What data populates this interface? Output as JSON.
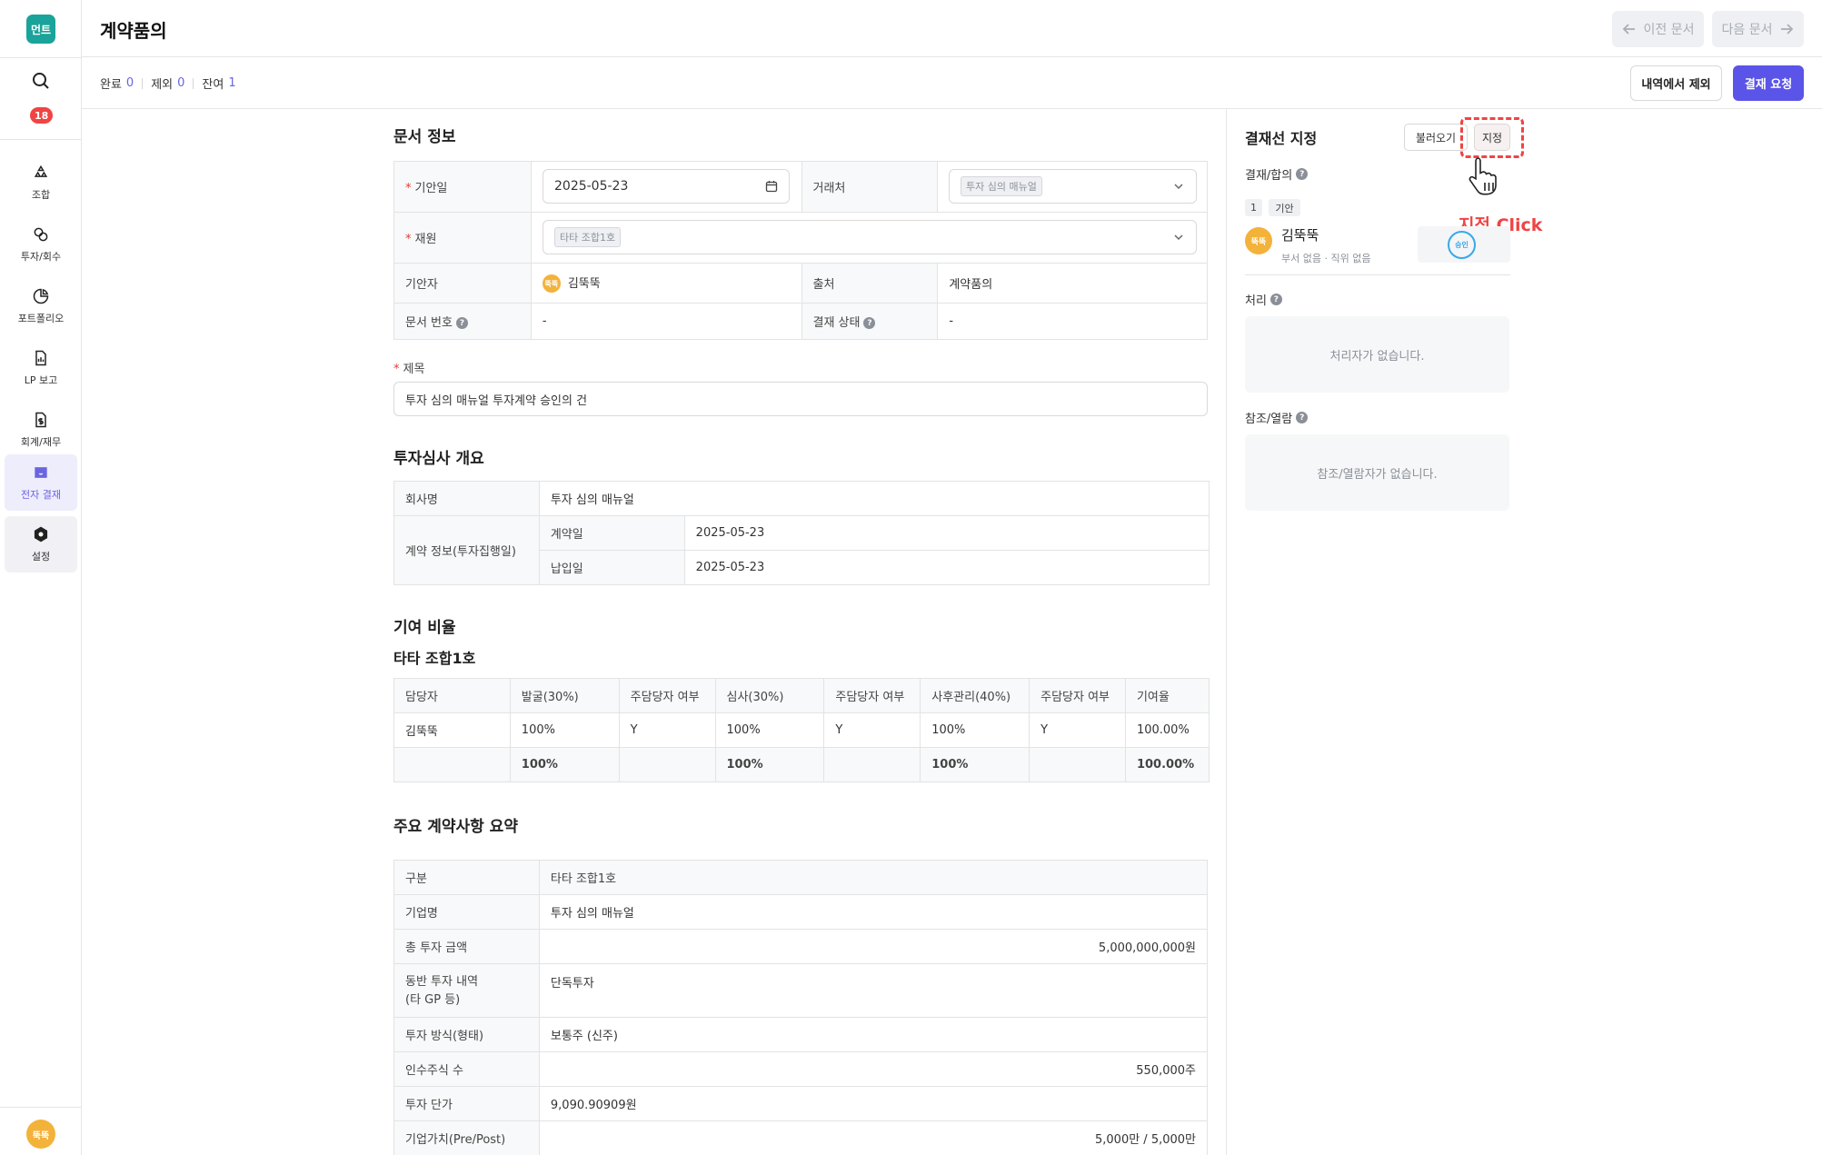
{
  "sidebar": {
    "logo_text": "먼트",
    "badge_count": "18",
    "items": [
      {
        "label": "조합",
        "icon": "recycle-icon"
      },
      {
        "label": "투자/회수",
        "icon": "coins-icon"
      },
      {
        "label": "포트폴리오",
        "icon": "pie-chart-icon"
      },
      {
        "label": "LP 보고",
        "icon": "report-file-icon"
      },
      {
        "label": "회계/재무",
        "icon": "dollar-file-icon"
      },
      {
        "label": "전자 결재",
        "icon": "inbox-icon"
      },
      {
        "label": "설정",
        "icon": "settings-icon"
      }
    ],
    "avatar_text": "뚝뚝"
  },
  "header": {
    "title": "계약품의",
    "prev_label": "이전 문서",
    "next_label": "다음 문서"
  },
  "subbar": {
    "done_label": "완료",
    "done_count": "0",
    "excluded_label": "제외",
    "excluded_count": "0",
    "remain_label": "잔여",
    "remain_count": "1",
    "exclude_button": "내역에서 제외",
    "request_button": "결재 요청"
  },
  "doc_info": {
    "title": "문서 정보",
    "draft_date_label": "기안일",
    "draft_date": "2025-05-23",
    "partner_label": "거래처",
    "partner_tag": "투자 심의 매뉴얼",
    "fund_label": "재원",
    "fund_tag": "타타 조합1호",
    "drafter_label": "기안자",
    "drafter_avatar": "뚝뚝",
    "drafter_name": "김뚝뚝",
    "source_label": "출처",
    "source_value": "계약품의",
    "doc_no_label": "문서 번호",
    "doc_no_value": "-",
    "status_label": "결재 상태",
    "status_value": "-",
    "subject_label": "제목",
    "subject_value": "투자 심의 매뉴얼 투자계약 승인의 건"
  },
  "review": {
    "title": "투자심사 개요",
    "company_label": "회사명",
    "company_value": "투자 심의 매뉴얼",
    "contract_info_label": "계약 정보(투자집행일)",
    "contract_date_label": "계약일",
    "contract_date": "2025-05-23",
    "payment_date_label": "납입일",
    "payment_date": "2025-05-23"
  },
  "contribution": {
    "title": "기여 비율",
    "fund_name": "타타 조합1호",
    "headers": [
      "담당자",
      "발굴(30%)",
      "주담당자 여부",
      "심사(30%)",
      "주담당자 여부",
      "사후관리(40%)",
      "주담당자 여부",
      "기여율"
    ],
    "row": [
      "김뚝뚝",
      "100%",
      "Y",
      "100%",
      "Y",
      "100%",
      "Y",
      "100.00%"
    ],
    "total": [
      "",
      "100%",
      "",
      "100%",
      "",
      "100%",
      "",
      "100.00%"
    ]
  },
  "summary": {
    "title": "주요 계약사항 요약",
    "rows": [
      {
        "label": "구분",
        "value": "타타 조합1호",
        "align": "left"
      },
      {
        "label": "기업명",
        "value": "투자 심의 매뉴얼",
        "align": "left"
      },
      {
        "label": "총 투자 금액",
        "value": "5,000,000,000원",
        "align": "right"
      },
      {
        "label": "동반 투자 내역",
        "label2": "(타 GP 등)",
        "value": "단독투자",
        "align": "left"
      },
      {
        "label": "투자 방식(형태)",
        "value": "보통주 (신주)",
        "align": "left"
      },
      {
        "label": "인수주식 수",
        "value": "550,000주",
        "align": "right"
      },
      {
        "label": "투자 단가",
        "value": "9,090.90909원",
        "align": "left"
      },
      {
        "label": "기업가치(Pre/Post)",
        "value": "5,000만 / 5,000만",
        "align": "right"
      }
    ]
  },
  "approval_panel": {
    "title": "결재선 지정",
    "load_button": "불러오기",
    "assign_button": "지정",
    "approve_label": "결재/합의",
    "step_number": "1",
    "step_type": "기안",
    "approver_avatar": "뚝뚝",
    "approver_name": "김뚝뚝",
    "approver_meta": "부서 없음 · 직위 없음",
    "stamp_text": "승인",
    "process_label": "처리",
    "process_empty": "처리자가 없습니다.",
    "reference_label": "참조/열람",
    "reference_empty": "참조/열람자가 없습니다."
  },
  "annotation": {
    "text": "지정 Click",
    "color": "#ef4444"
  },
  "colors": {
    "primary": "#5b54e8",
    "logo": "#1aa39a",
    "avatar": "#f3b23a",
    "badge": "#ef4444"
  }
}
